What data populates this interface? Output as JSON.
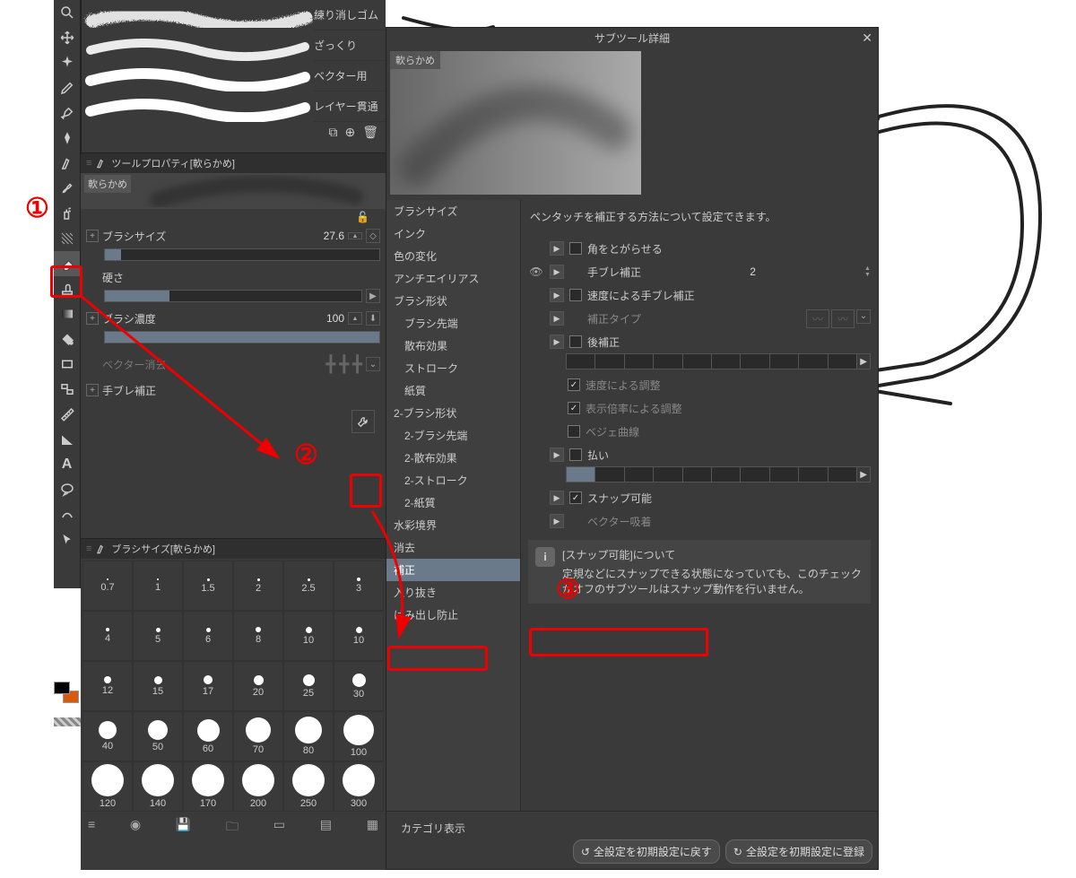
{
  "toolbar": {
    "icons": [
      "magnify",
      "move",
      "sparkle",
      "pencil",
      "pen",
      "nib",
      "calligraphy",
      "brush",
      "spray",
      "pattern",
      "eraser-selected",
      "stamp",
      "gradient",
      "fill",
      "rect",
      "frame",
      "ruler",
      "triangle",
      "text",
      "balloon",
      "line",
      "cursor"
    ]
  },
  "colors": {
    "fg": "#000000",
    "bg": "#d85a0a"
  },
  "subtool": {
    "brushes": [
      {
        "name": "練り消しゴム",
        "style": "rough"
      },
      {
        "name": "ざっくり",
        "style": "scratch"
      },
      {
        "name": "ベクター用",
        "style": "smooth"
      },
      {
        "name": "レイヤー貫通",
        "style": "smooth"
      }
    ],
    "bottom_buttons": [
      "duplicate",
      "add",
      "delete"
    ]
  },
  "property": {
    "title": "ツールプロパティ[軟らかめ]",
    "preview_label": "軟らかめ",
    "brushsize_label": "ブラシサイズ",
    "brushsize_value": "27.6",
    "hardness_label": "硬さ",
    "density_label": "ブラシ濃度",
    "density_value": "100",
    "vector_erase_label": "ベクター消去",
    "stabilize_label": "手ブレ補正",
    "wrench_label": "詳細設定"
  },
  "brushsize": {
    "title": "ブラシサイズ[軟らかめ]",
    "sizes": [
      "0.7",
      "1",
      "1.5",
      "2",
      "2.5",
      "3",
      "4",
      "5",
      "6",
      "8",
      "10",
      "10",
      "12",
      "15",
      "17",
      "20",
      "25",
      "30",
      "40",
      "50",
      "60",
      "70",
      "80",
      "100",
      "120",
      "140",
      "170",
      "200",
      "250",
      "300"
    ],
    "bottom_icons": [
      "menu",
      "record",
      "save",
      "folder",
      "card",
      "queue",
      "queue2"
    ]
  },
  "detail": {
    "title": "サブツール詳細",
    "preview_label": "軟らかめ",
    "categories": [
      {
        "k": "brushsize",
        "label": "ブラシサイズ"
      },
      {
        "k": "ink",
        "label": "インク"
      },
      {
        "k": "colorchange",
        "label": "色の変化"
      },
      {
        "k": "aa",
        "label": "アンチエイリアス"
      },
      {
        "k": "bshape",
        "label": "ブラシ形状"
      },
      {
        "k": "btip",
        "label": "ブラシ先端",
        "sub": true
      },
      {
        "k": "scatter",
        "label": "散布効果",
        "sub": true
      },
      {
        "k": "stroke",
        "label": "ストローク",
        "sub": true
      },
      {
        "k": "paper",
        "label": "紙質",
        "sub": true
      },
      {
        "k": "bshape2",
        "label": "2-ブラシ形状"
      },
      {
        "k": "btip2",
        "label": "2-ブラシ先端",
        "sub": true
      },
      {
        "k": "scatter2",
        "label": "2-散布効果",
        "sub": true
      },
      {
        "k": "stroke2",
        "label": "2-ストローク",
        "sub": true
      },
      {
        "k": "paper2",
        "label": "2-紙質",
        "sub": true
      },
      {
        "k": "border",
        "label": "水彩境界"
      },
      {
        "k": "erase",
        "label": "消去"
      },
      {
        "k": "correct",
        "label": "補正",
        "selected": true
      },
      {
        "k": "startend",
        "label": "入り抜き"
      },
      {
        "k": "overflow",
        "label": "はみ出し防止"
      }
    ],
    "description": "ペンタッチを補正する方法について設定できます。",
    "rows": {
      "sharp_angle": "角をとがらせる",
      "stabilize": "手ブレ補正",
      "stabilize_value": "2",
      "speed_stabilize": "速度による手ブレ補正",
      "correct_type": "補正タイプ",
      "post_correct": "後補正",
      "adj_speed": "速度による調整",
      "adj_zoom": "表示倍率による調整",
      "bezier": "ベジェ曲線",
      "taper": "払い",
      "snap": "スナップ可能",
      "vector_snap": "ベクター吸着"
    },
    "info": {
      "title": "[スナップ可能]について",
      "body": "定規などにスナップできる状態になっていても、このチェックがオフのサブツールはスナップ動作を行いません。"
    },
    "category_show": "カテゴリ表示",
    "reset_button": "全設定を初期設定に戻す",
    "save_button": "全設定を初期設定に登録"
  },
  "annotations": {
    "n1": "①",
    "n2": "②",
    "n3": "③"
  }
}
